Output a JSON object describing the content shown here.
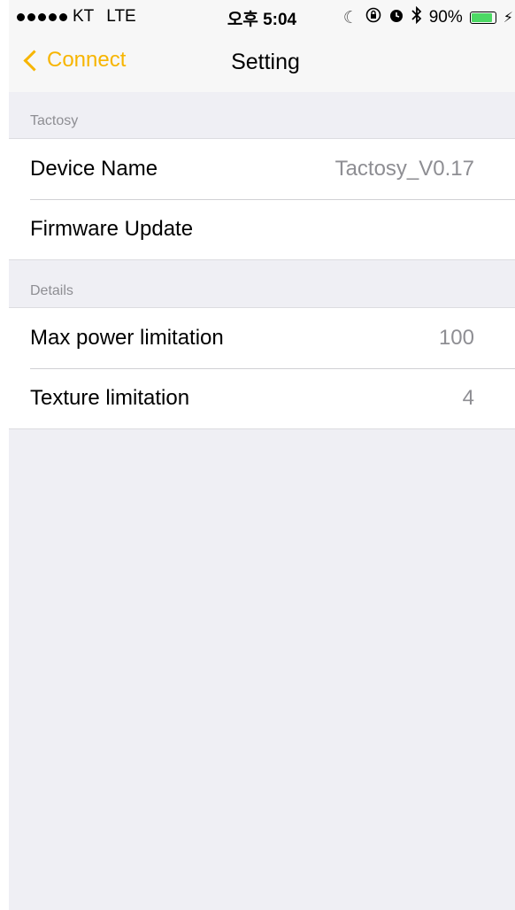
{
  "status_bar": {
    "carrier": "KT",
    "network": "LTE",
    "time": "오후 5:04",
    "battery": "90%",
    "battery_level": 0.9
  },
  "nav": {
    "back_label": "Connect",
    "title": "Setting"
  },
  "sections": [
    {
      "header": "Tactosy",
      "rows": [
        {
          "label": "Device Name",
          "value": "Tactosy_V0.17"
        },
        {
          "label": "Firmware Update",
          "value": ""
        }
      ]
    },
    {
      "header": "Details",
      "rows": [
        {
          "label": "Max power limitation",
          "value": "100"
        },
        {
          "label": "Texture limitation",
          "value": "4"
        }
      ]
    }
  ],
  "colors": {
    "accent": "#f7b500",
    "background": "#efeff4",
    "secondary_text": "#8e8e93"
  },
  "icons": [
    "moon-icon",
    "orientation-lock-icon",
    "alarm-icon",
    "bluetooth-icon",
    "battery-icon",
    "charging-icon",
    "chevron-left-icon"
  ]
}
